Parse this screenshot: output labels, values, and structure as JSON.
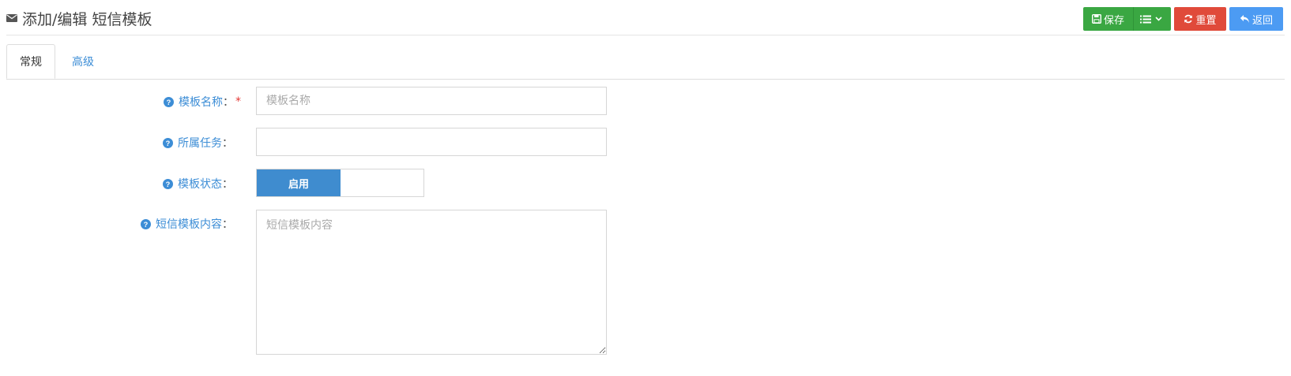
{
  "header": {
    "title": "添加/编辑 短信模板",
    "title_icon": "envelope-icon"
  },
  "toolbar": {
    "save_label": "保存",
    "reset_label": "重置",
    "back_label": "返回",
    "colors": {
      "save": "#3aa742",
      "reset": "#e04a3a",
      "back": "#4c9bf3"
    }
  },
  "tabs": [
    {
      "label": "常规",
      "active": true
    },
    {
      "label": "高级",
      "active": false
    }
  ],
  "form": {
    "name": {
      "label": "模板名称",
      "placeholder": "模板名称",
      "value": "",
      "required": "*"
    },
    "task": {
      "label": "所属任务",
      "value": ""
    },
    "status": {
      "label": "模板状态",
      "on_label": "启用"
    },
    "content": {
      "label": "短信模板内容",
      "placeholder": "短信模板内容",
      "value": ""
    },
    "colon": "："
  },
  "accent_color": "#3c8dd6"
}
